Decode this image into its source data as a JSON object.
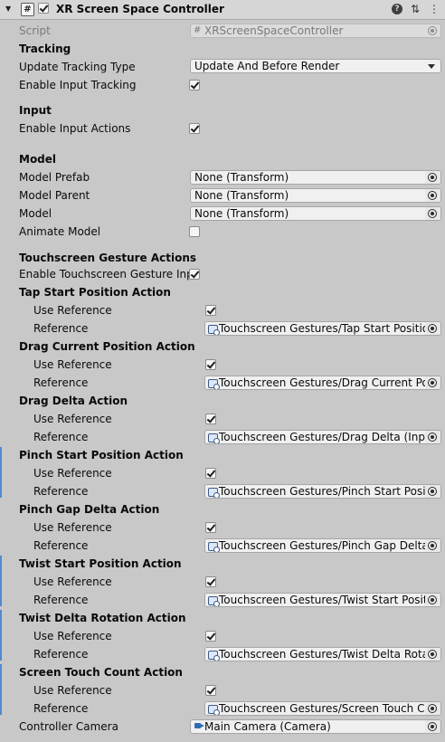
{
  "header": {
    "title": "XR Screen Space Controller",
    "fold_glyph": "▼",
    "script_glyph": "#",
    "help_glyph": "?",
    "presets_glyph": "⇅",
    "menu_glyph": "⋮"
  },
  "script": {
    "label": "Script",
    "value": "XRScreenSpaceController"
  },
  "tracking": {
    "header": "Tracking",
    "update_label": "Update Tracking Type",
    "update_value": "Update And Before Render",
    "enable_label": "Enable Input Tracking",
    "enable_checked": true
  },
  "input": {
    "header": "Input",
    "enable_label": "Enable Input Actions",
    "enable_checked": true
  },
  "model": {
    "header": "Model",
    "prefab_label": "Model Prefab",
    "prefab_value": "None (Transform)",
    "parent_label": "Model Parent",
    "parent_value": "None (Transform)",
    "model_label": "Model",
    "model_value": "None (Transform)",
    "animate_label": "Animate Model",
    "animate_checked": false
  },
  "touch": {
    "header": "Touchscreen Gesture Actions",
    "enable_label": "Enable Touchscreen Gesture Inpu",
    "enable_checked": true,
    "use_reference_label": "Use Reference",
    "reference_label": "Reference",
    "actions": [
      {
        "name": "Tap Start Position Action",
        "reference": "Touchscreen Gestures/Tap Start Position"
      },
      {
        "name": "Drag Current Position Action",
        "reference": "Touchscreen Gestures/Drag Current Posi"
      },
      {
        "name": "Drag Delta Action",
        "reference": "Touchscreen Gestures/Drag Delta (Input"
      },
      {
        "name": "Pinch Start Position Action",
        "reference": "Touchscreen Gestures/Pinch Start Positi"
      },
      {
        "name": "Pinch Gap Delta Action",
        "reference": "Touchscreen Gestures/Pinch Gap Delta ("
      },
      {
        "name": "Twist Start Position Action",
        "reference": "Touchscreen Gestures/Twist Start Positi"
      },
      {
        "name": "Twist Delta Rotation Action",
        "reference": "Touchscreen Gestures/Twist Delta Rotat"
      },
      {
        "name": "Screen Touch Count Action",
        "reference": "Touchscreen Gestures/Screen Touch Co"
      }
    ]
  },
  "camera": {
    "label": "Controller Camera",
    "value": "Main Camera (Camera)"
  }
}
